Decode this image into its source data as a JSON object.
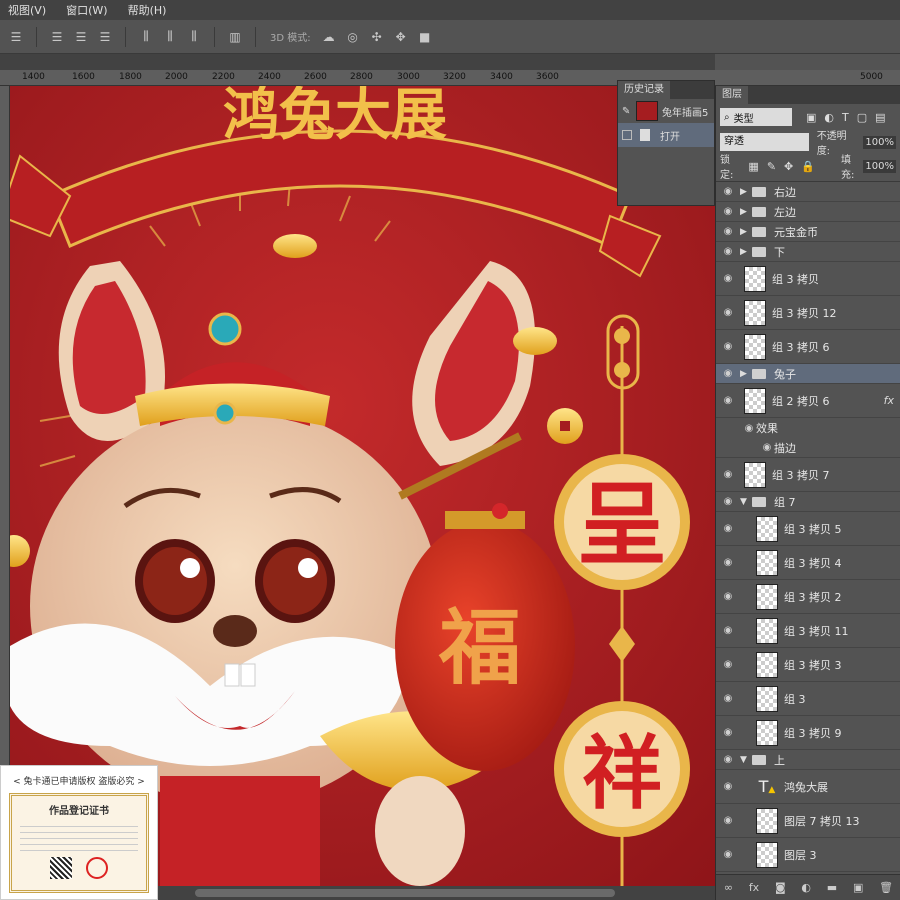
{
  "menu": {
    "items": [
      "视图(V)",
      "窗口(W)",
      "帮助(H)"
    ]
  },
  "options": {
    "mode_label": "3D 模式:"
  },
  "ruler": {
    "labels": [
      "1400",
      "1600",
      "1800",
      "2000",
      "2200",
      "2400",
      "2600",
      "2800",
      "3000",
      "3200",
      "3400",
      "3600",
      "5000"
    ]
  },
  "history": {
    "tab": "历史记录",
    "snapshot": "兔年插画5",
    "step": "打开"
  },
  "layers": {
    "tab": "图层",
    "filter": "类型",
    "blend": "穿透",
    "opacity_label": "不透明度:",
    "opacity": "100%",
    "lock_label": "锁定:",
    "fill_label": "填充:",
    "fill": "100%",
    "rows": [
      {
        "name": "右边",
        "kind": "group"
      },
      {
        "name": "左边",
        "kind": "group"
      },
      {
        "name": "元宝金币",
        "kind": "group"
      },
      {
        "name": "下",
        "kind": "group"
      },
      {
        "name": "组 3 拷贝",
        "kind": "layer"
      },
      {
        "name": "组 3 拷贝 12",
        "kind": "layer"
      },
      {
        "name": "组 3 拷贝 6",
        "kind": "layer"
      },
      {
        "name": "兔子",
        "kind": "group-selected"
      },
      {
        "name": "组 2 拷贝 6",
        "kind": "layer-fx"
      },
      {
        "name": "效果",
        "kind": "effect"
      },
      {
        "name": "描边",
        "kind": "effect"
      },
      {
        "name": "组 3 拷贝 7",
        "kind": "layer"
      },
      {
        "name": "组 7",
        "kind": "group-open"
      },
      {
        "name": "组 3 拷贝 5",
        "kind": "sub"
      },
      {
        "name": "组 3 拷贝 4",
        "kind": "sub"
      },
      {
        "name": "组 3 拷贝 2",
        "kind": "sub"
      },
      {
        "name": "组 3 拷贝 11",
        "kind": "sub"
      },
      {
        "name": "组 3 拷贝 3",
        "kind": "sub"
      },
      {
        "name": "组 3",
        "kind": "sub"
      },
      {
        "name": "组 3 拷贝 9",
        "kind": "sub"
      },
      {
        "name": "上",
        "kind": "group-open"
      },
      {
        "name": "鸿兔大展",
        "kind": "text"
      },
      {
        "name": "图层 7 拷贝 13",
        "kind": "sub"
      },
      {
        "name": "图层 3",
        "kind": "sub"
      }
    ]
  },
  "artwork": {
    "banner": "鸿兔大展",
    "disc1": "呈",
    "lantern": "福",
    "disc2": "祥"
  },
  "certificate": {
    "caption": "< 兔卡通已申请版权 盗版必究 >",
    "title": "作品登记证书"
  }
}
